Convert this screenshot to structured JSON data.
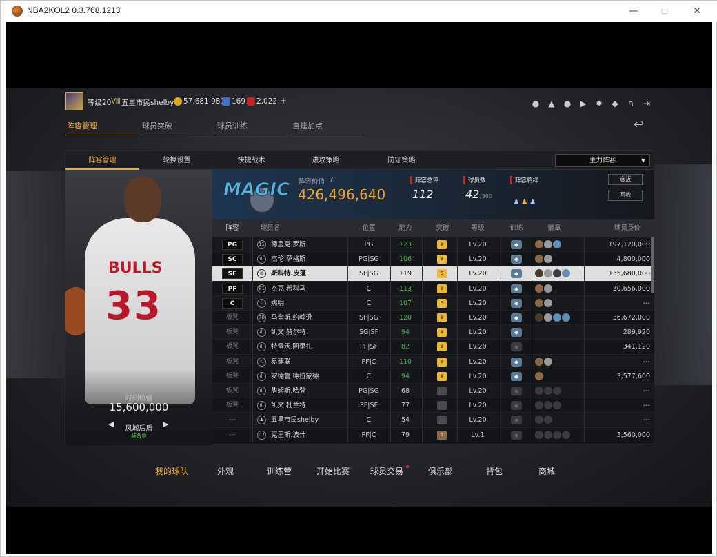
{
  "window": {
    "title": "NBA2KOL2 0.3.768.1213",
    "minimize": "—",
    "maximize": "☐",
    "close": "✕"
  },
  "topbar": {
    "level": "等级20",
    "rank_badge": "Ⅷ",
    "username": "五星市民shelby",
    "coins": "57,681,981",
    "stars": "169",
    "tickets": "2,022",
    "add": "+",
    "icons": [
      "user-icon",
      "bell-icon",
      "friends-icon",
      "video-icon",
      "settings-icon",
      "shield-icon",
      "headset-icon",
      "exit-icon"
    ]
  },
  "main_tabs": [
    "阵容管理",
    "球员突破",
    "球员训练",
    "自建加点"
  ],
  "sub_tabs": [
    "阵容管理",
    "轮换设置",
    "快捷战术",
    "进攻策略",
    "防守策略"
  ],
  "lineup_select": "主力阵容",
  "player_card": {
    "team_text": "BULLS",
    "jersey": "33",
    "value_label": "时刻价值",
    "value": "15,600,000",
    "position": "风城后盾",
    "status": "装备中",
    "prev": "◀",
    "next": "▶"
  },
  "team_info": {
    "logo_text": "MAGIC",
    "value_label": "阵容价值",
    "value": "426,496,640",
    "score_label": "阵容总评",
    "score": "112",
    "count_label": "球员数",
    "count": "42",
    "count_max": "/300",
    "bond_label": "阵容羁绊",
    "select_btn": "选拔",
    "recycle_btn": "回收"
  },
  "table": {
    "headers": [
      "阵容",
      "球员名",
      "位置",
      "能力",
      "突破",
      "等级",
      "训练",
      "徽章",
      "球员身价"
    ],
    "rows": [
      {
        "slot": "PG",
        "starter": true,
        "icon": "11",
        "name": "德里克.罗斯",
        "pos": "PG",
        "rating": "123",
        "green": true,
        "bt": "gold",
        "bt_text": "♛",
        "level": "Lv.20",
        "train": "on",
        "badges": [
          "bronze",
          "silver",
          "blue"
        ],
        "value": "197,120,000"
      },
      {
        "slot": "SC",
        "starter": true,
        "icon": "ıll",
        "name": "杰伦.萨格斯",
        "pos": "PG|SG",
        "rating": "106",
        "green": true,
        "bt": "gold",
        "bt_text": "♛",
        "level": "Lv.20",
        "train": "on",
        "badges": [
          "bronze",
          "silver"
        ],
        "value": "4,800,000"
      },
      {
        "slot": "SF",
        "starter": true,
        "sel": true,
        "icon": "◍",
        "name": "斯科特.皮蓬",
        "pos": "SF|SG",
        "rating": "119",
        "green": false,
        "bt": "gold",
        "bt_text": "6",
        "level": "Lv.20",
        "train": "on",
        "badges": [
          "dark",
          "silver",
          "empty",
          "blue"
        ],
        "value": "135,680,000"
      },
      {
        "slot": "PF",
        "starter": true,
        "icon": "81",
        "name": "杰克.希科马",
        "pos": "C",
        "rating": "113",
        "green": true,
        "bt": "gold",
        "bt_text": "♛",
        "level": "Lv.20",
        "train": "on",
        "badges": [
          "bronze",
          "silver"
        ],
        "value": "30,656,000"
      },
      {
        "slot": "C",
        "starter": true,
        "icon": "☆",
        "name": "姚明",
        "pos": "C",
        "rating": "107",
        "green": true,
        "bt": "gold",
        "bt_text": "6",
        "level": "Lv.20",
        "train": "on",
        "badges": [
          "bronze",
          "silver"
        ],
        "value": "---"
      },
      {
        "slot": "板凳",
        "starter": false,
        "icon": "78",
        "name": "马奎斯.约翰逊",
        "pos": "SF|SG",
        "rating": "120",
        "green": true,
        "bt": "gold",
        "bt_text": "♛",
        "level": "Lv.20",
        "train": "on",
        "badges": [
          "dark",
          "silver",
          "blue",
          "blue"
        ],
        "value": "36,672,000"
      },
      {
        "slot": "板凳",
        "starter": false,
        "icon": "ıll",
        "name": "凯文.赫尔特",
        "pos": "SG|SF",
        "rating": "94",
        "green": true,
        "bt": "gold",
        "bt_text": "♛",
        "level": "Lv.20",
        "train": "on",
        "badges": [],
        "value": "289,920"
      },
      {
        "slot": "板凳",
        "starter": false,
        "icon": "ıll",
        "name": "特雷沃.阿里扎",
        "pos": "PF|SF",
        "rating": "82",
        "green": true,
        "bt": "gold",
        "bt_text": "♛",
        "level": "Lv.20",
        "train": "off",
        "badges": [],
        "value": "341,120"
      },
      {
        "slot": "板凳",
        "starter": false,
        "icon": "☆",
        "name": "易建联",
        "pos": "PF|C",
        "rating": "110",
        "green": true,
        "bt": "gold",
        "bt_text": "♛",
        "level": "Lv.20",
        "train": "on",
        "badges": [
          "bronze",
          "silver"
        ],
        "value": "---"
      },
      {
        "slot": "板凳",
        "starter": false,
        "icon": "ıll",
        "name": "安德鲁.德拉蒙德",
        "pos": "C",
        "rating": "94",
        "green": true,
        "bt": "gold",
        "bt_text": "♛",
        "level": "Lv.20",
        "train": "on",
        "badges": [
          "bronze"
        ],
        "value": "3,577,600"
      },
      {
        "slot": "板凳",
        "starter": false,
        "icon": "ıll",
        "name": "詹姆斯.哈登",
        "pos": "PG|SG",
        "rating": "68",
        "green": false,
        "bt": "grey",
        "bt_text": "",
        "level": "Lv.20",
        "train": "off",
        "badges": [
          "empty",
          "empty",
          "empty"
        ],
        "value": "---"
      },
      {
        "slot": "板凳",
        "starter": false,
        "icon": "ıll",
        "name": "凯文.杜兰特",
        "pos": "PF|SF",
        "rating": "77",
        "green": false,
        "bt": "grey",
        "bt_text": "",
        "level": "Lv.20",
        "train": "off",
        "badges": [
          "empty",
          "empty",
          "empty"
        ],
        "value": "---"
      },
      {
        "slot": "---",
        "starter": false,
        "icon": "♟",
        "name": "五星市民shelby",
        "pos": "C",
        "rating": "54",
        "green": false,
        "bt": "grey",
        "bt_text": "",
        "level": "Lv.20",
        "train": "off",
        "badges": [
          "empty",
          "empty"
        ],
        "value": "---"
      },
      {
        "slot": "---",
        "starter": false,
        "icon": "07",
        "name": "克里斯.波什",
        "pos": "PF|C",
        "rating": "79",
        "green": false,
        "bt": "brown",
        "bt_text": "1",
        "level": "Lv.1",
        "train": "off",
        "badges": [
          "empty",
          "empty",
          "empty",
          "empty"
        ],
        "value": "3,560,000"
      }
    ]
  },
  "bottom_nav": [
    "我的球队",
    "外观",
    "训练营",
    "开始比赛",
    "球员交易",
    "俱乐部",
    "背包",
    "商城"
  ]
}
